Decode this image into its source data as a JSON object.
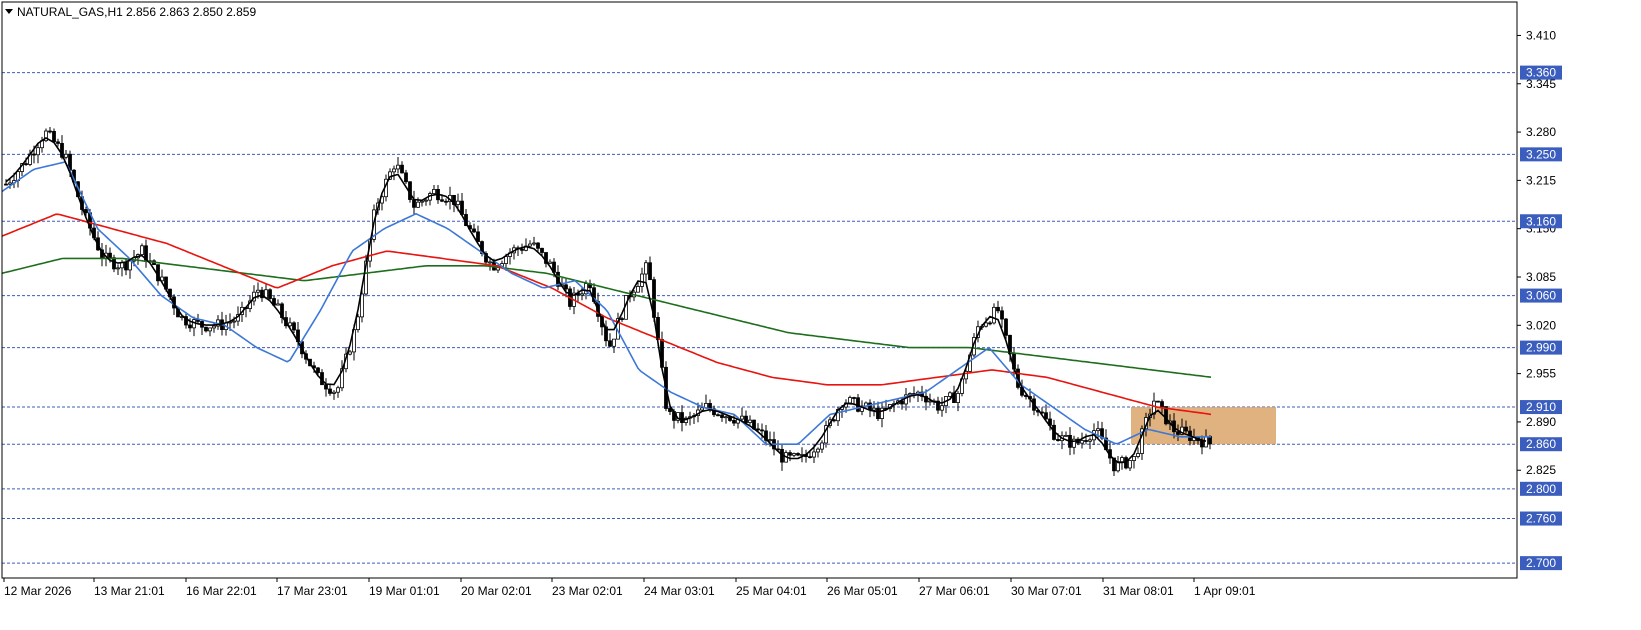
{
  "header": {
    "symbol": "NATURAL_GAS,H1",
    "ohlc": "2.856 2.863 2.850 2.859"
  },
  "colors": {
    "candle": "#000000",
    "ma_fast": "#000000",
    "ma_mid": "#3c78d8",
    "ma_red": "#e8140e",
    "ma_green": "#1e6e1e",
    "level_line": "#3a5dbe",
    "level_label_bg": "#3a5dbe",
    "zone_fill": "#d9a46a"
  },
  "chart_data": {
    "type": "candlestick",
    "ylim": [
      2.68,
      3.455
    ],
    "y_ticks": [
      "3.410",
      "3.345",
      "3.280",
      "3.215",
      "3.150",
      "3.085",
      "3.020",
      "2.955",
      "2.890",
      "2.825"
    ],
    "x_ticks": [
      "12 Mar 2026",
      "13 Mar 21:01",
      "16 Mar 22:01",
      "17 Mar 23:01",
      "19 Mar 01:01",
      "20 Mar 02:01",
      "23 Mar 02:01",
      "24 Mar 03:01",
      "25 Mar 04:01",
      "26 Mar 05:01",
      "27 Mar 06:01",
      "30 Mar 07:01",
      "31 Mar 08:01",
      "1 Apr 09:01"
    ],
    "levels": [
      "3.360",
      "3.250",
      "3.160",
      "3.060",
      "2.990",
      "2.910",
      "2.860",
      "2.800",
      "2.760",
      "2.700"
    ],
    "zone": {
      "top": 2.91,
      "bottom": 2.86
    },
    "anchors": {
      "close": [
        3.21,
        3.24,
        3.28,
        3.25,
        3.17,
        3.11,
        3.1,
        3.12,
        3.08,
        3.03,
        3.02,
        3.02,
        3.03,
        3.07,
        3.04,
        3.0,
        2.95,
        2.93,
        3.02,
        3.18,
        3.24,
        3.18,
        3.2,
        3.19,
        3.14,
        3.1,
        3.12,
        3.13,
        3.1,
        3.05,
        3.08,
        2.99,
        3.06,
        3.1,
        2.9,
        2.89,
        2.91,
        2.9,
        2.89,
        2.87,
        2.84,
        2.84,
        2.87,
        2.92,
        2.91,
        2.9,
        2.92,
        2.93,
        2.91,
        2.93,
        3.02,
        3.04,
        2.94,
        2.91,
        2.87,
        2.86,
        2.88,
        2.83,
        2.84,
        2.92,
        2.88,
        2.87,
        2.86
      ],
      "ma_mid": [
        3.2,
        3.23,
        3.24,
        3.15,
        3.11,
        3.06,
        3.03,
        3.02,
        2.99,
        2.97,
        3.04,
        3.12,
        3.15,
        3.17,
        3.15,
        3.12,
        3.09,
        3.07,
        3.08,
        3.04,
        2.96,
        2.93,
        2.91,
        2.9,
        2.86,
        2.86,
        2.9,
        2.91,
        2.92,
        2.93,
        2.96,
        2.99,
        2.94,
        2.91,
        2.88,
        2.86,
        2.88,
        2.87,
        2.87
      ],
      "ma_red": [
        3.14,
        3.17,
        3.15,
        3.13,
        3.1,
        3.07,
        3.1,
        3.12,
        3.11,
        3.1,
        3.07,
        3.03,
        3.0,
        2.97,
        2.95,
        2.94,
        2.94,
        2.95,
        2.96,
        2.95,
        2.93,
        2.91,
        2.9
      ],
      "ma_green": [
        3.09,
        3.11,
        3.11,
        3.1,
        3.09,
        3.08,
        3.09,
        3.1,
        3.1,
        3.09,
        3.07,
        3.05,
        3.03,
        3.01,
        3.0,
        2.99,
        2.99,
        2.98,
        2.97,
        2.96,
        2.95
      ]
    }
  }
}
